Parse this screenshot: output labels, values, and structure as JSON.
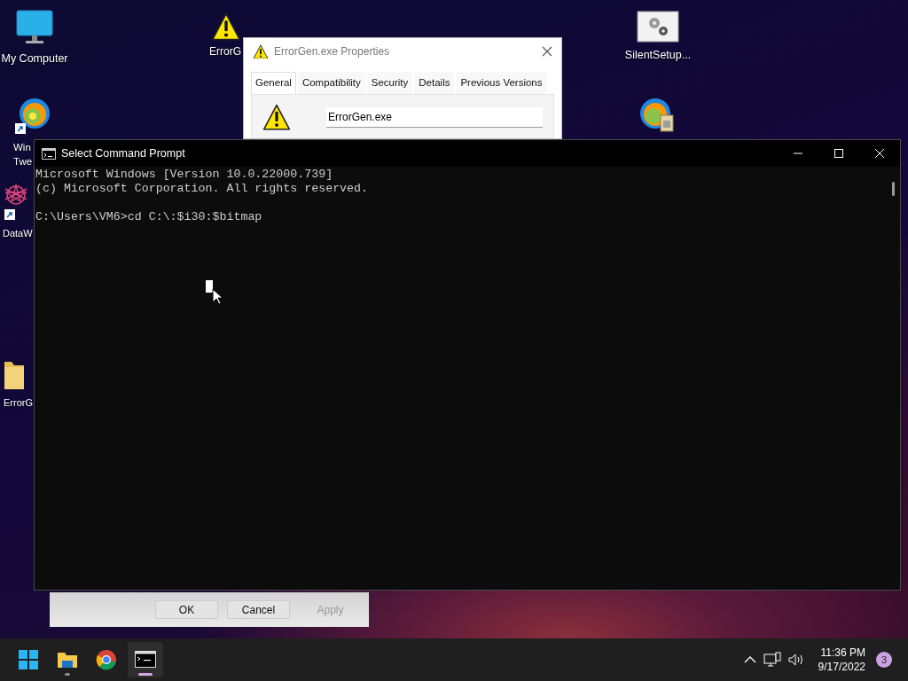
{
  "desktop_icons": [
    {
      "kind": "monitor",
      "label_lines": [
        "My Computer"
      ]
    },
    {
      "kind": "warning",
      "label_lines": [
        "ErrorG"
      ]
    },
    {
      "kind": "setup",
      "label_lines": [
        "SilentSetup..."
      ]
    },
    {
      "kind": "swirl",
      "shortcut": true,
      "label_lines": [
        "Win",
        "Twe"
      ]
    },
    {
      "kind": "swirl-package"
    },
    {
      "kind": "star",
      "shortcut": true,
      "label_lines": [
        "DataW"
      ]
    },
    {
      "kind": "folder",
      "label_lines": [
        "ErrorG"
      ]
    }
  ],
  "properties_window": {
    "title": "ErrorGen.exe Properties",
    "tabs": [
      {
        "label": "General",
        "selected": true
      },
      {
        "label": "Compatibility",
        "selected": false
      },
      {
        "label": "Security",
        "selected": false
      },
      {
        "label": "Details",
        "selected": false
      },
      {
        "label": "Previous Versions",
        "selected": false
      }
    ],
    "file_name": "ErrorGen.exe",
    "buttons": [
      {
        "label": "OK",
        "disabled": false
      },
      {
        "label": "Cancel",
        "disabled": false
      },
      {
        "label": "Apply",
        "disabled": true
      }
    ]
  },
  "console_window": {
    "title": "Select Command Prompt",
    "output": [
      "Microsoft Windows [Version 10.0.22000.739]",
      "(c) Microsoft Corporation. All rights reserved."
    ],
    "input_line": "C:\\Users\\VM6>cd C:\\:$i30:$bitmap"
  },
  "taskbar": {
    "apps": [
      {
        "kind": "start",
        "running": false,
        "active": false
      },
      {
        "kind": "explorer",
        "running": true,
        "active": false
      },
      {
        "kind": "chrome",
        "running": false,
        "active": false
      },
      {
        "kind": "terminal",
        "running": true,
        "active": true
      }
    ],
    "time": "11:36 PM",
    "date": "9/17/2022",
    "notification_count": "3"
  }
}
